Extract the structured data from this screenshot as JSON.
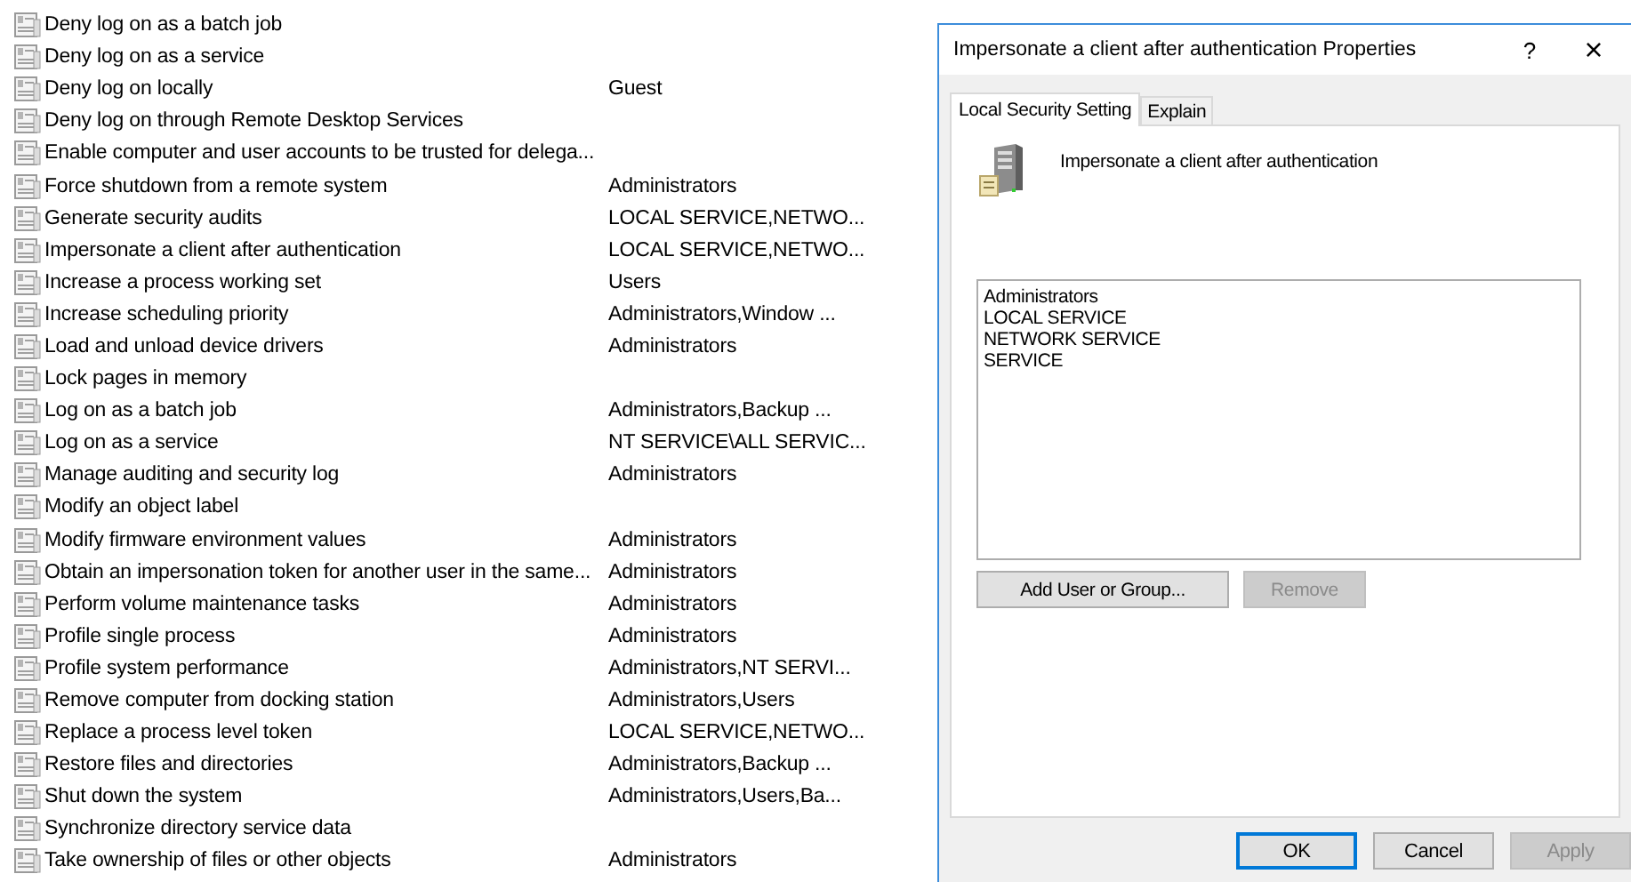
{
  "policies": [
    {
      "name": "Deny log on as a batch job"
    },
    {
      "name": "Deny log on as a service"
    },
    {
      "name": "Deny log on locally",
      "setting": "Guest"
    },
    {
      "name": "Deny log on through Remote Desktop Services"
    },
    {
      "name": "Enable computer and user accounts to be trusted for delega..."
    },
    {
      "name": "Force shutdown from a remote system",
      "setting": "Administrators"
    },
    {
      "name": "Generate security audits",
      "setting": "LOCAL SERVICE,NETWO..."
    },
    {
      "name": "Impersonate a client after authentication",
      "setting": "LOCAL SERVICE,NETWO..."
    },
    {
      "name": "Increase a process working set",
      "setting": "Users"
    },
    {
      "name": "Increase scheduling priority",
      "setting": "Administrators,Window ..."
    },
    {
      "name": "Load and unload device drivers",
      "setting": "Administrators"
    },
    {
      "name": "Lock pages in memory"
    },
    {
      "name": "Log on as a batch job",
      "setting": "Administrators,Backup ..."
    },
    {
      "name": "Log on as a service",
      "setting": "NT SERVICE\\ALL SERVIC..."
    },
    {
      "name": "Manage auditing and security log",
      "setting": "Administrators"
    },
    {
      "name": "Modify an object label"
    },
    {
      "name": "Modify firmware environment values",
      "setting": "Administrators"
    },
    {
      "name": "Obtain an impersonation token for another user in the same...",
      "setting": "Administrators"
    },
    {
      "name": "Perform volume maintenance tasks",
      "setting": "Administrators"
    },
    {
      "name": "Profile single process",
      "setting": "Administrators"
    },
    {
      "name": "Profile system performance",
      "setting": "Administrators,NT SERVI..."
    },
    {
      "name": "Remove computer from docking station",
      "setting": "Administrators,Users"
    },
    {
      "name": "Replace a process level token",
      "setting": "LOCAL SERVICE,NETWO..."
    },
    {
      "name": "Restore files and directories",
      "setting": "Administrators,Backup ..."
    },
    {
      "name": "Shut down the system",
      "setting": "Administrators,Users,Ba..."
    },
    {
      "name": "Synchronize directory service data"
    },
    {
      "name": "Take ownership of files or other objects",
      "setting": "Administrators"
    }
  ],
  "dialog": {
    "title": "Impersonate a client after authentication Properties",
    "help": "?",
    "close": "×",
    "tabs": [
      {
        "label": "Local Security Setting",
        "selected": true
      },
      {
        "label": "Explain",
        "selected": false
      }
    ],
    "heading": "Impersonate a client after authentication",
    "members": [
      "Administrators",
      "LOCAL SERVICE",
      "NETWORK SERVICE",
      "SERVICE"
    ],
    "list_buttons": [
      {
        "label": "Add User or Group...",
        "disabled": false
      },
      {
        "label": "Remove",
        "disabled": true
      }
    ],
    "buttons": [
      {
        "label": "OK",
        "disabled": false,
        "default": true
      },
      {
        "label": "Cancel",
        "disabled": false,
        "default": false
      },
      {
        "label": "Apply",
        "disabled": true,
        "default": false
      }
    ]
  }
}
